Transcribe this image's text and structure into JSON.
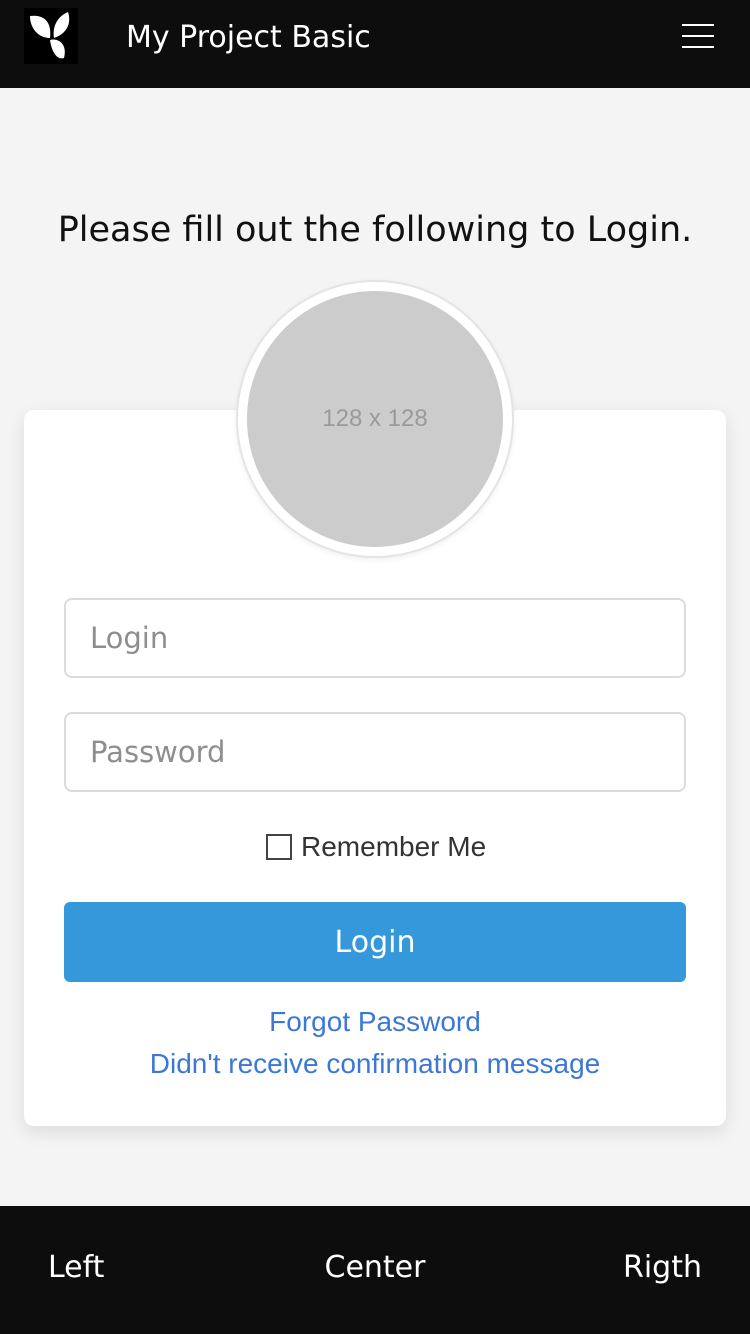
{
  "navbar": {
    "logo_icon": "yii-logo-icon",
    "title": "My Project Basic",
    "menu_icon": "hamburger-menu-icon"
  },
  "login": {
    "heading": "Please fill out the following to Login.",
    "avatar_placeholder": "128 x 128",
    "login_placeholder": "Login",
    "login_value": "",
    "password_placeholder": "Password",
    "password_value": "",
    "remember_label": "Remember Me",
    "remember_checked": false,
    "submit_label": "Login",
    "forgot_link": "Forgot Password",
    "confirm_link": "Didn't receive confirmation message"
  },
  "footer": {
    "left": "Left",
    "center": "Center",
    "right": "Rigth"
  },
  "colors": {
    "navbar_bg": "#0d0d0d",
    "page_bg": "#f4f4f4",
    "button_bg": "#3498db",
    "link": "#3b78d6"
  }
}
